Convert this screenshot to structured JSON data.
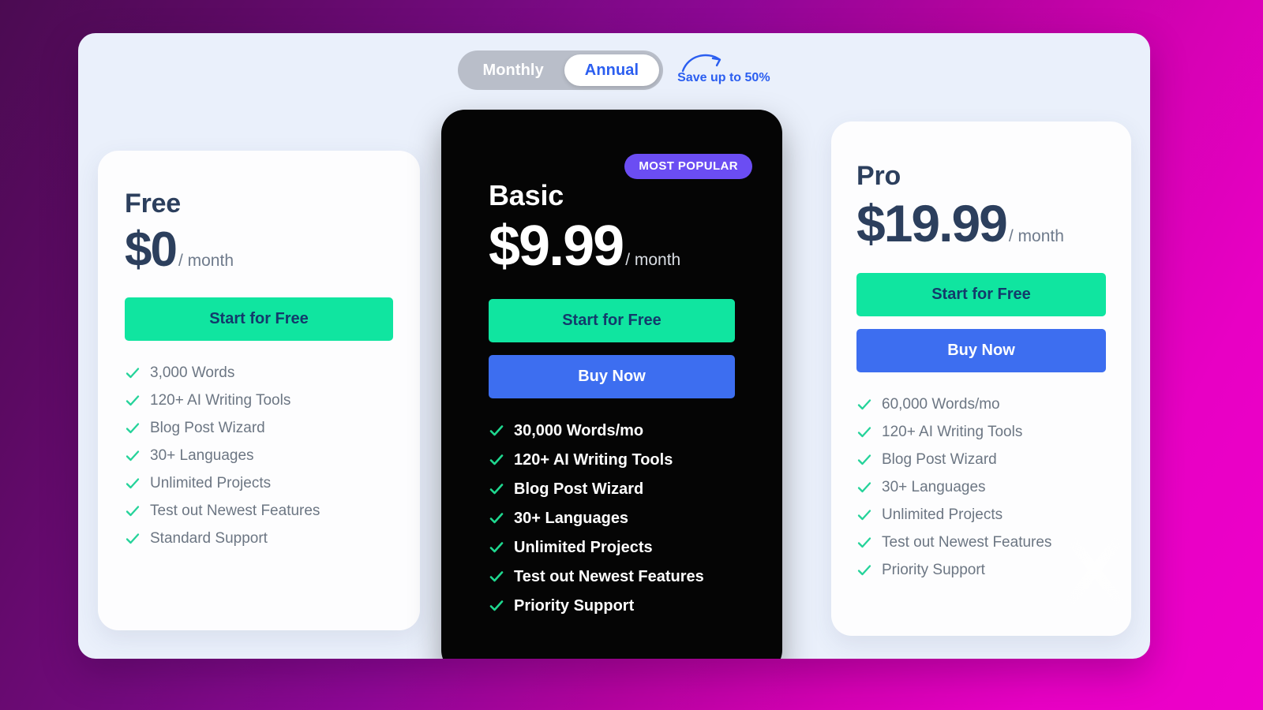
{
  "billing_toggle": {
    "monthly_label": "Monthly",
    "annual_label": "Annual",
    "active": "Annual",
    "save_note": "Save up to 50%"
  },
  "colors": {
    "accent_green": "#10e5a0",
    "accent_blue": "#3d6ef0",
    "badge_purple": "#6b4df3",
    "heading_navy": "#2c3f5d",
    "panel_bg": "#eaf0fb",
    "dark_card": "#050505"
  },
  "plans": [
    {
      "name": "Free",
      "price": "$0",
      "period": "/ month",
      "badge": null,
      "buttons": [
        {
          "label": "Start for Free",
          "style": "green"
        }
      ],
      "features": [
        "3,000 Words",
        "120+ AI Writing Tools",
        "Blog Post Wizard",
        "30+ Languages",
        "Unlimited Projects",
        "Test out Newest Features",
        "Standard Support"
      ]
    },
    {
      "name": "Basic",
      "price": "$9.99",
      "period": "/ month",
      "badge": "MOST POPULAR",
      "buttons": [
        {
          "label": "Start for Free",
          "style": "green"
        },
        {
          "label": "Buy Now",
          "style": "blue"
        }
      ],
      "features": [
        "30,000 Words/mo",
        "120+ AI Writing Tools",
        "Blog Post Wizard",
        "30+ Languages",
        "Unlimited Projects",
        "Test out Newest Features",
        "Priority Support"
      ]
    },
    {
      "name": "Pro",
      "price": "$19.99",
      "period": "/ month",
      "badge": null,
      "buttons": [
        {
          "label": "Start for Free",
          "style": "green"
        },
        {
          "label": "Buy Now",
          "style": "blue"
        }
      ],
      "features": [
        "60,000 Words/mo",
        "120+ AI Writing Tools",
        "Blog Post Wizard",
        "30+ Languages",
        "Unlimited Projects",
        "Test out Newest Features",
        "Priority Support"
      ]
    }
  ]
}
